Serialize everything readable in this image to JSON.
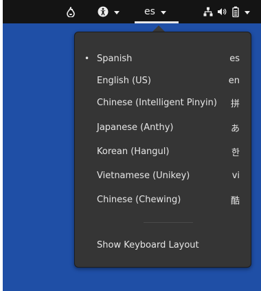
{
  "topbar": {
    "keyboard_indicator": "es",
    "icons": [
      "flame-icon",
      "accessibility-icon",
      "network-icon",
      "volume-icon",
      "battery-icon"
    ]
  },
  "menu": {
    "items": [
      {
        "label": "Spanish",
        "code": "es",
        "active": true,
        "bullet": "•"
      },
      {
        "label": "English (US)",
        "code": "en",
        "active": false
      },
      {
        "label": "Chinese (Intelligent Pinyin)",
        "code": "拼",
        "active": false
      },
      {
        "label": "Japanese (Anthy)",
        "code": "あ",
        "active": false
      },
      {
        "label": "Korean (Hangul)",
        "code": "한",
        "active": false
      },
      {
        "label": "Vietnamese (Unikey)",
        "code": "vi",
        "active": false
      },
      {
        "label": "Chinese (Chewing)",
        "code": "酷",
        "active": false
      }
    ],
    "show_keyboard_layout_label": "Show Keyboard Layout"
  },
  "colors": {
    "topbar": "#141414",
    "menu_bg": "#353535",
    "desktop": "#1f4fa6",
    "text": "#e6e6e6"
  }
}
